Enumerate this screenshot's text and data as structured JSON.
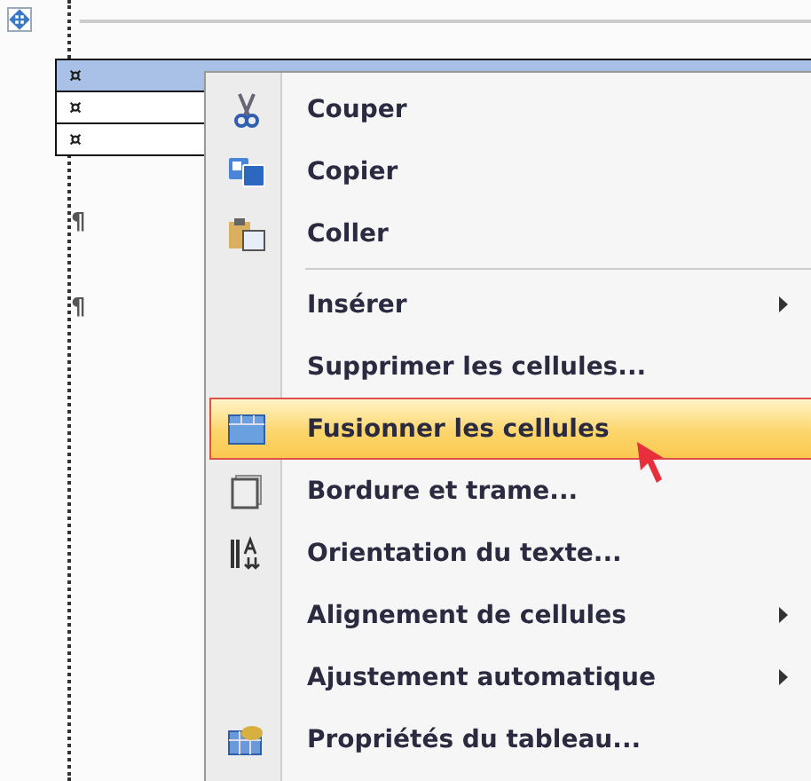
{
  "document": {
    "table_rows": [
      {
        "marker": "¤",
        "selected": true
      },
      {
        "marker": "¤",
        "selected": false
      },
      {
        "marker": "¤",
        "selected": false
      }
    ],
    "paragraph_marks": [
      "¶",
      "¶"
    ]
  },
  "context_menu": {
    "items": [
      {
        "kind": "item",
        "label": "Couper",
        "submenu": false,
        "selected": false
      },
      {
        "kind": "item",
        "label": "Copier",
        "submenu": false,
        "selected": false
      },
      {
        "kind": "item",
        "label": "Coller",
        "submenu": false,
        "selected": false
      },
      {
        "kind": "separator"
      },
      {
        "kind": "item",
        "label": "Insérer",
        "submenu": true,
        "selected": false
      },
      {
        "kind": "item",
        "label": "Supprimer les cellules...",
        "submenu": false,
        "selected": false
      },
      {
        "kind": "item",
        "label": "Fusionner les cellules",
        "submenu": false,
        "selected": true
      },
      {
        "kind": "item",
        "label": "Bordure et trame...",
        "submenu": false,
        "selected": false
      },
      {
        "kind": "item",
        "label": "Orientation du texte...",
        "submenu": false,
        "selected": false
      },
      {
        "kind": "item",
        "label": "Alignement de cellules",
        "submenu": true,
        "selected": false
      },
      {
        "kind": "item",
        "label": "Ajustement automatique",
        "submenu": true,
        "selected": false
      },
      {
        "kind": "item",
        "label": "Propriétés du tableau...",
        "submenu": false,
        "selected": false
      }
    ]
  }
}
